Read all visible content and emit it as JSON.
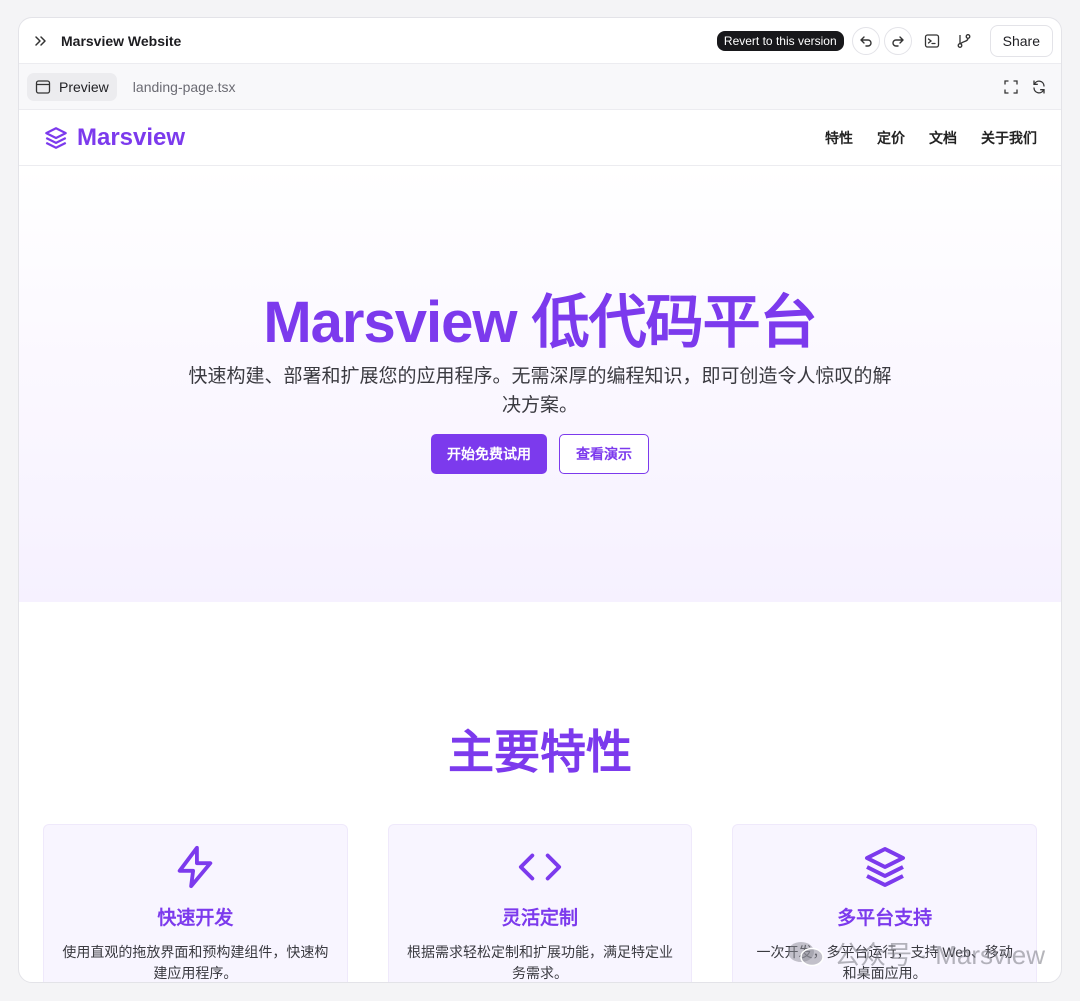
{
  "header": {
    "title": "Marsview Website",
    "revert_label": "Revert to this version",
    "share_label": "Share"
  },
  "tabs": {
    "preview_label": "Preview",
    "file_label": "landing-page.tsx"
  },
  "site": {
    "brand": "Marsview",
    "nav": [
      "特性",
      "定价",
      "文档",
      "关于我们"
    ],
    "hero": {
      "title": "Marsview 低代码平台",
      "subtitle": "快速构建、部署和扩展您的应用程序。无需深厚的编程知识，即可创造令人惊叹的解决方案。",
      "primary_cta": "开始免费试用",
      "secondary_cta": "查看演示"
    },
    "features_title": "主要特性",
    "features": [
      {
        "icon": "lightning-icon",
        "title": "快速开发",
        "desc": "使用直观的拖放界面和预构建组件，快速构建应用程序。"
      },
      {
        "icon": "code-icon",
        "title": "灵活定制",
        "desc": "根据需求轻松定制和扩展功能，满足特定业务需求。"
      },
      {
        "icon": "layers-icon",
        "title": "多平台支持",
        "desc": "一次开发，多平台运行，支持 Web、移动和桌面应用。"
      }
    ]
  },
  "watermark": "公众号 · Marsview",
  "colors": {
    "accent": "#7c3aed",
    "dark": "#18181b"
  }
}
